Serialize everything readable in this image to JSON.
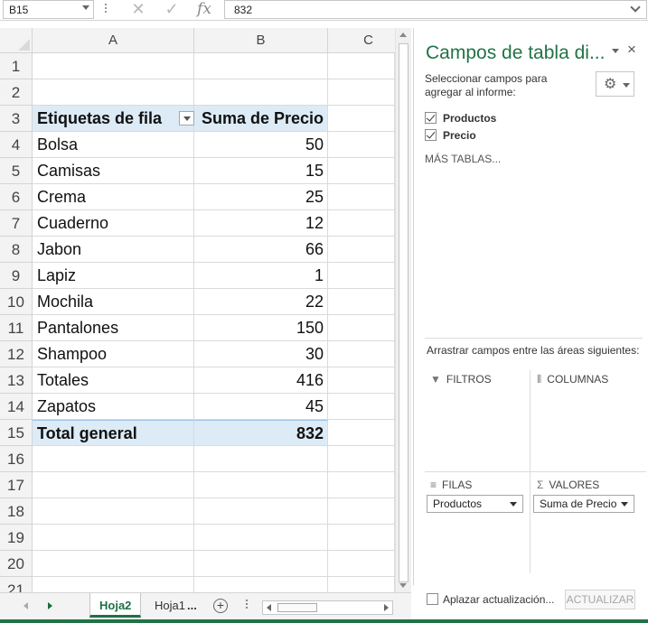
{
  "formula_bar": {
    "name_box": "B15",
    "cancel_icon": "✕",
    "enter_icon": "✓",
    "fx": "fx",
    "formula": "832"
  },
  "columns": [
    "A",
    "B",
    "C"
  ],
  "rows": [
    {
      "n": "1",
      "a": "",
      "b": ""
    },
    {
      "n": "2",
      "a": "",
      "b": ""
    },
    {
      "n": "3",
      "a": "Etiquetas de fila",
      "b": "Suma de Precio",
      "style": "header"
    },
    {
      "n": "4",
      "a": "Bolsa",
      "b": "50"
    },
    {
      "n": "5",
      "a": "Camisas",
      "b": "15"
    },
    {
      "n": "6",
      "a": "Crema",
      "b": "25"
    },
    {
      "n": "7",
      "a": "Cuaderno",
      "b": "12"
    },
    {
      "n": "8",
      "a": "Jabon",
      "b": "66"
    },
    {
      "n": "9",
      "a": "Lapiz",
      "b": "1"
    },
    {
      "n": "10",
      "a": "Mochila",
      "b": "22"
    },
    {
      "n": "11",
      "a": "Pantalones",
      "b": "150"
    },
    {
      "n": "12",
      "a": "Shampoo",
      "b": "30"
    },
    {
      "n": "13",
      "a": "Totales",
      "b": "416"
    },
    {
      "n": "14",
      "a": "Zapatos",
      "b": "45"
    },
    {
      "n": "15",
      "a": "Total general",
      "b": "832",
      "style": "total"
    },
    {
      "n": "16",
      "a": "",
      "b": ""
    },
    {
      "n": "17",
      "a": "",
      "b": ""
    },
    {
      "n": "18",
      "a": "",
      "b": ""
    },
    {
      "n": "19",
      "a": "",
      "b": ""
    },
    {
      "n": "20",
      "a": "",
      "b": ""
    },
    {
      "n": "21",
      "a": "",
      "b": ""
    }
  ],
  "sheet_tabs": {
    "tabs": [
      "Hoja2",
      "Hoja1"
    ],
    "more": "...",
    "add": "+"
  },
  "pivot_pane": {
    "title": "Campos de tabla di...",
    "close": "×",
    "subtitle": "Seleccionar campos para agregar al informe:",
    "gear": "⚙",
    "fields": [
      {
        "label": "Productos",
        "checked": true
      },
      {
        "label": "Precio",
        "checked": true
      }
    ],
    "more_tables": "MÁS TABLAS...",
    "drag_text": "Arrastrar campos entre las áreas siguientes:",
    "areas": {
      "filters": {
        "icon": "filter-icon",
        "label": "FILTROS"
      },
      "columns": {
        "icon": "columns-icon",
        "label": "COLUMNAS"
      },
      "rows": {
        "icon": "rows-icon",
        "label": "FILAS",
        "chip": "Productos"
      },
      "values": {
        "icon": "sigma-icon",
        "label": "VALORES",
        "chip": "Suma de Precio"
      }
    },
    "defer_label": "Aplazar actualización...",
    "update_button": "ACTUALIZAR"
  },
  "colors": {
    "accent_green": "#217346",
    "pivot_header_fill": "#ddebf7"
  }
}
